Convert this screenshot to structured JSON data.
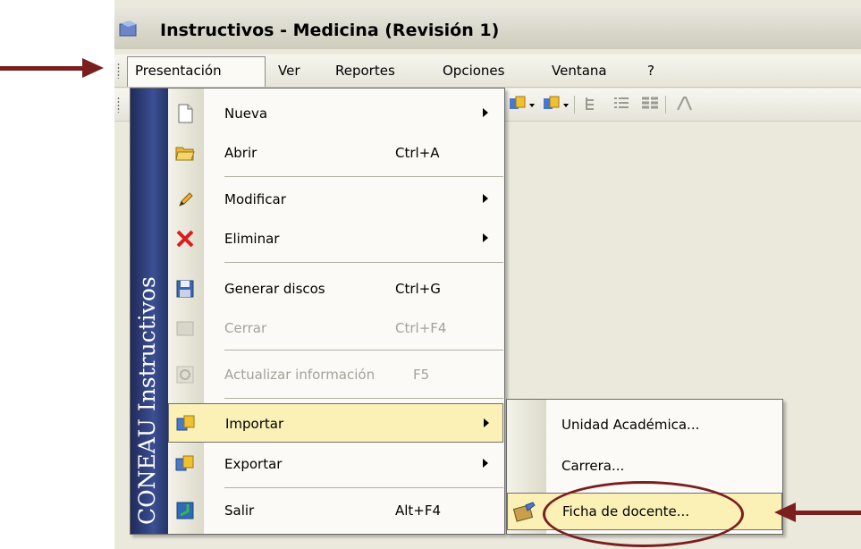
{
  "window": {
    "title": "Instructivos - Medicina (Revisión 1)"
  },
  "menubar": {
    "items": [
      {
        "label": "Presentación",
        "mnemonic": "P"
      },
      {
        "label": "Ver",
        "mnemonic": "V"
      },
      {
        "label": "Reportes",
        "mnemonic": "R"
      },
      {
        "label": "Opciones",
        "mnemonic": "O"
      },
      {
        "label": "Ventana",
        "mnemonic": "V"
      },
      {
        "label": "?",
        "mnemonic": "?"
      }
    ]
  },
  "dropdown": {
    "sidebar_text": "CONEAU Instructivos",
    "items": [
      {
        "label": "Nueva",
        "shortcut": "",
        "submenu": true,
        "enabled": true,
        "icon": "new-document-icon"
      },
      {
        "label": "Abrir",
        "shortcut": "Ctrl+A",
        "submenu": false,
        "enabled": true,
        "icon": "open-folder-icon"
      },
      {
        "label": "Modificar",
        "shortcut": "",
        "submenu": true,
        "enabled": true,
        "icon": "pencil-icon"
      },
      {
        "label": "Eliminar",
        "shortcut": "",
        "submenu": true,
        "enabled": true,
        "icon": "delete-x-icon"
      },
      {
        "label": "Generar discos",
        "shortcut": "Ctrl+G",
        "submenu": false,
        "enabled": true,
        "icon": "floppy-disk-icon"
      },
      {
        "label": "Cerrar",
        "shortcut": "Ctrl+F4",
        "submenu": false,
        "enabled": false,
        "icon": "close-window-icon"
      },
      {
        "label": "Actualizar información",
        "shortcut": "F5",
        "submenu": false,
        "enabled": false,
        "icon": "refresh-icon"
      },
      {
        "label": "Importar",
        "shortcut": "",
        "submenu": true,
        "enabled": true,
        "icon": "import-icon",
        "highlighted": true
      },
      {
        "label": "Exportar",
        "shortcut": "",
        "submenu": true,
        "enabled": true,
        "icon": "export-icon"
      },
      {
        "label": "Salir",
        "shortcut": "Alt+F4",
        "submenu": false,
        "enabled": true,
        "icon": "exit-icon"
      }
    ]
  },
  "submenu": {
    "items": [
      {
        "label": "Unidad Académica...",
        "icon": ""
      },
      {
        "label": "Carrera...",
        "icon": ""
      },
      {
        "label": "Ficha de docente...",
        "icon": "edit-card-icon",
        "highlighted": true
      }
    ]
  },
  "colors": {
    "annotation": "#7a1e1e",
    "highlight": "#fbf0b6",
    "sidebar": "#2d3c78"
  }
}
